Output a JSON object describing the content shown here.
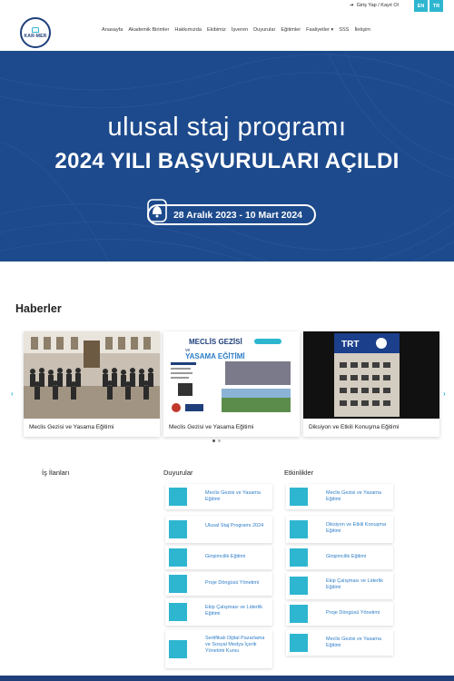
{
  "topbar": {
    "login": "Giriş Yap / Kayıt Ol",
    "lang_en": "EN",
    "lang_tr": "TR"
  },
  "logo": {
    "text": "KAR-MER"
  },
  "nav": [
    "Anasayfa",
    "Akademik Birimler",
    "Hakkımızda",
    "Ekibimiz",
    "İşveren",
    "Duyurular",
    "Eğitimler",
    "Faaliyetler ▾",
    "SSS",
    "İletişim"
  ],
  "banner": {
    "line1": "ulusal staj programı",
    "line2": "2024 YILI BAŞVURULARI AÇILDI",
    "date": "28 Aralık 2023 - 10 Mart 2024"
  },
  "news": {
    "title": "Haberler",
    "cards": [
      {
        "caption": "Meclis Gezisi ve Yasama Eğitimi"
      },
      {
        "caption": "Meclis Gezisi ve Yasama Eğitimi",
        "poster_title": "MECLİS GEZİSİ",
        "poster_sub1": "ve",
        "poster_sub2": "YASAMA EĞİTİMİ"
      },
      {
        "caption": "Diksiyon ve Etkili Konuşma Eğitimi",
        "screen_text": "TRT"
      }
    ]
  },
  "columns": {
    "is_ilanlari": {
      "title": "İş İlanları"
    },
    "duyurular": {
      "title": "Duyurular",
      "items": [
        "Meclis Gezisi ve Yasama Eğitimi",
        "Ulusal Staj Programı 2024",
        "Girişimcilik Eğitimi",
        "Proje Döngüsü Yönetimi",
        "Ekip Çalışması ve Liderlik Eğitimi",
        "Sertifikalı Dijital Pazarlama ve Sosyal Medya İçerik Yönetimi Kursu"
      ]
    },
    "etkinlikler": {
      "title": "Etkinlikler",
      "items": [
        "Meclis Gezisi ve Yasama Eğitimi",
        "Diksiyon ve Etkili Konuşma Eğitimi",
        "Girişimcilik Eğitimi",
        "Ekip Çalışması ve Liderlik Eğitimi",
        "Proje Döngüsü Yönetimi",
        "Meclis Gezisi ve Yasama Eğitimi"
      ]
    }
  },
  "colors": {
    "accent": "#2eb6d0",
    "banner": "#1d4a8c",
    "navy": "#1e3f7a",
    "link": "#2e7dc8"
  }
}
